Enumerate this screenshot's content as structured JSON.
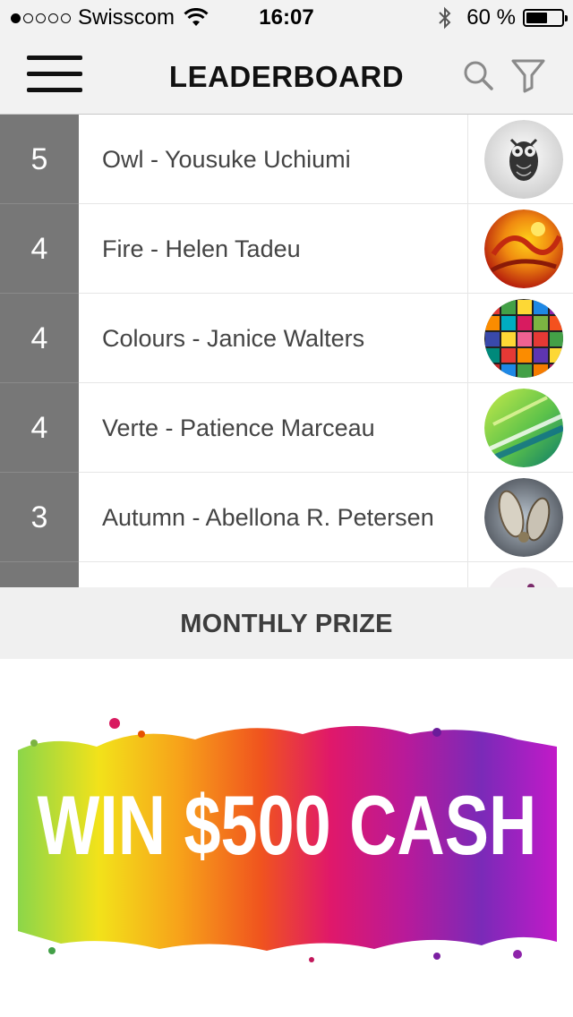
{
  "status_bar": {
    "carrier": "Swisscom",
    "signal_bars": 1,
    "signal_total": 5,
    "time": "16:07",
    "battery_text": "60 %",
    "battery_level": 0.6
  },
  "header": {
    "title": "LEADERBOARD",
    "menu_icon": "hamburger-menu-icon",
    "search_icon": "search-icon",
    "filter_icon": "filter-icon"
  },
  "leaderboard": [
    {
      "rank": "5",
      "name": "Owl - Yousuke Uchiumi",
      "thumbnail": "owl-artwork"
    },
    {
      "rank": "4",
      "name": "Fire - Helen Tadeu",
      "thumbnail": "fire-artwork"
    },
    {
      "rank": "4",
      "name": "Colours - Janice Walters",
      "thumbnail": "colours-artwork"
    },
    {
      "rank": "4",
      "name": "Verte - Patience Marceau",
      "thumbnail": "verte-artwork"
    },
    {
      "rank": "3",
      "name": "Autumn - Abellona R. Petersen",
      "thumbnail": "autumn-artwork"
    },
    {
      "rank": "",
      "name": "",
      "thumbnail": "partial-artwork"
    }
  ],
  "prize": {
    "heading": "MONTHLY PRIZE",
    "banner_text": "WIN $500 CASH"
  }
}
